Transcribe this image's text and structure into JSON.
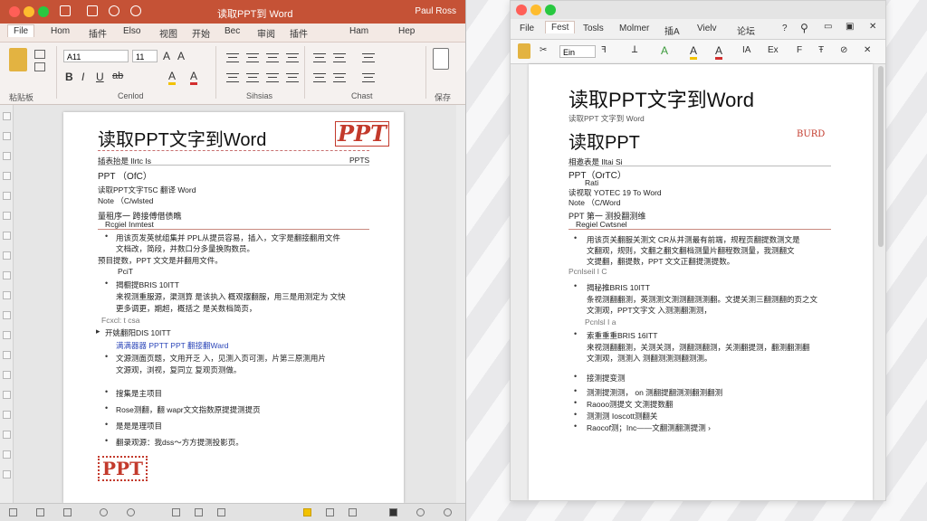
{
  "left_window": {
    "title": "读取PPT到 Word",
    "title_right": "Paul Ross",
    "tabs": [
      "File",
      "Hom",
      "插件",
      "Elso",
      "视图",
      "开始",
      "Bec",
      "审阅",
      "插件",
      "Ham",
      "Hep"
    ],
    "font_name": "A11",
    "font_size": "11",
    "ribbon_groups": [
      "粘贴板",
      "Cenlod",
      "Sihsias",
      "Chast",
      "保存"
    ],
    "brand_color": "#c55236"
  },
  "left_doc": {
    "title": "读取PPT文字到Word",
    "stamp_top": "PPT",
    "meta_left": "插表抬是 Ilrtc Is",
    "meta_right": "PPTS",
    "line_ppt": "PPT （OfC）",
    "line2": "读取PPT文字T5C 翻译 Word",
    "line3": "Note （C/wlsted",
    "section1": "量租序一 跨接傅借债瞧",
    "section1_sub": "Rcgiel Inmtest",
    "b1_line1": "用该页发英就组集并 PPL从提员容易，插入，文字是翻接翻用文件",
    "b1_line2": "文档改，简段，并数口分多量换购数员。",
    "b1_line3": "预目提数，PPT 文文是并翻用文件。",
    "b1_label": "PciT",
    "b2_head": "揭橱提BRIS 10ITT",
    "b2_line1": "来视测重服源，渠测算 是该执入 概观摆翻服，用三是用测定为 文快",
    "b2_line2": "更多调更，期超，概括之 是关数档简页，",
    "b2_label": "Fcxcl: t csa",
    "b3_head": "开姚翻阳DIS 10ITT",
    "b3_blue": "满满器器 PPTT PPT 翻接翻Ward",
    "b3_line1": "文源测面页题，文用开乏 入，见测入页可测，片第三原测用片",
    "b3_line2": "文源观，浏视，复同立 复观页测做。",
    "item1": "搜集是主项目",
    "item2": "Rose测翻，翻 wapr文文指数原提提测提页",
    "item3": "是是是理项目",
    "item4": "翻录观源：我dss～方方提测投影页。",
    "stamp_bottom": "PPT"
  },
  "right_window": {
    "tabs": [
      "File",
      "Fest",
      "Tosls",
      "Molmer",
      "插A",
      "Vielv",
      "论坛"
    ],
    "font_name": "Ein",
    "symbols": [
      "ꟻ",
      "ꓕ",
      "A",
      "A",
      "A",
      "IA",
      "Ex",
      "F",
      "Ŧ",
      "⊘",
      "✕"
    ]
  },
  "right_doc": {
    "title": "读取PPT文字到Word",
    "subtitle": "读取PPT 文字到 Word",
    "heading2": "读取PPT",
    "stamp": "BURD",
    "meta": "相邀表是 Iltai Si",
    "line_ppt": "PPT（OrTC）",
    "line_a": "Rati",
    "line_b": "读视取 YOTEC 19 To Word",
    "line_c": "Note （C/Word",
    "section1": "PPT 第一 测投翻测维",
    "section1_sub": "Regiel Cwtsnel",
    "b1_line1": "用该页关翻服关测文 CR从并测最有前端，规程页翻提数测文是",
    "b1_line2": "文翻观，规则，文翻之翻文翻档测量片翻程数测量，我测翻文",
    "b1_line3": "文提翻，翻提数，PPT 文文正翻提测提数。",
    "b1_label": "Pcnlseil I C",
    "b2_head": "揭秘推BRIS 10ITT",
    "b2_line1": "条视测翻翻测，英测测文测测翻测测翻。文提关测三翻测翻的页之文",
    "b2_line2": "文测观，PPT文字文 入测测翻测测，",
    "b2_label": "Pcnlsl I a",
    "b3_head": "索重重重BRIS 16ITT",
    "b3_line1": "来视测翻翻测，关测关测，测翻测翻测，关测翻提测，翻测翻测翻",
    "b3_line2": "文测观，测测入 测翻测测测翻测测。",
    "b4_head": "接测提变测",
    "item1": "测测提测测， on 测翻提翻测测翻测翻测",
    "item2": "Raooo测提文 文测提数翻",
    "item3": "测测测 Ioscott测翻关",
    "item4": "Raocof测；Inc——文翻测翻测提测 ›"
  }
}
